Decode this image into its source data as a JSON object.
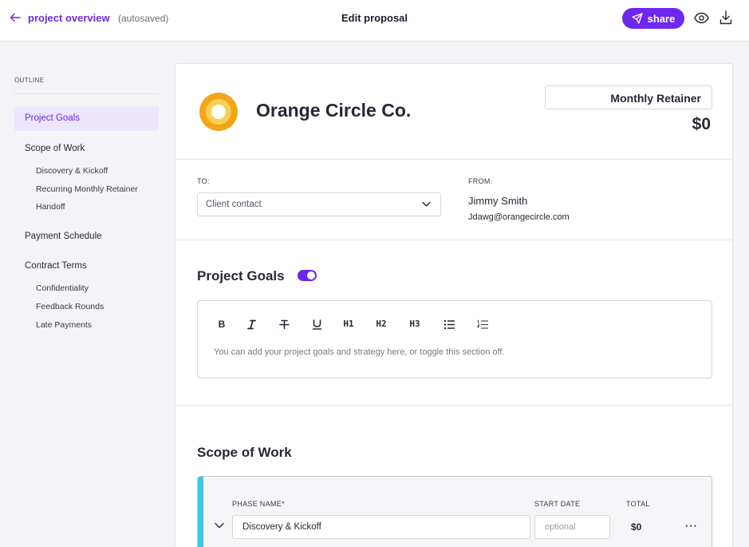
{
  "header": {
    "back_label": "project overview",
    "autosave_status": "(autosaved)",
    "title": "Edit proposal",
    "share_label": "share",
    "accent_color": "#6d28f0"
  },
  "sidebar": {
    "title": "OUTLINE",
    "items": [
      {
        "label": "Project Goals",
        "active": true,
        "children": []
      },
      {
        "label": "Scope of Work",
        "children": [
          "Discovery & Kickoff",
          "Recurring Monthly Retainer",
          "Handoff"
        ]
      },
      {
        "label": "Payment Schedule",
        "children": []
      },
      {
        "label": "Contract Terms",
        "children": [
          "Confidentiality",
          "Feedback Rounds",
          "Late Payments"
        ]
      }
    ]
  },
  "proposal": {
    "company_name": "Orange Circle Co.",
    "plan": "Monthly Retainer",
    "amount": "$0",
    "to_label": "TO:",
    "to_placeholder": "Client contact",
    "from_label": "FROM:",
    "from_name": "Jimmy Smith",
    "from_email": "Jdawg@orangecircle.com"
  },
  "project_goals": {
    "title": "Project Goals",
    "enabled": true,
    "toolbar": [
      "bold",
      "italic",
      "strikethrough",
      "underline",
      "H1",
      "H2",
      "H3",
      "bulleted-list",
      "numbered-list"
    ],
    "placeholder": "You can add your project goals and strategy here, or toggle this section off."
  },
  "scope_of_work": {
    "title": "Scope of Work",
    "columns": {
      "phase": "PHASE NAME*",
      "start": "START DATE",
      "total": "TOTAL"
    },
    "phases": [
      {
        "name": "Discovery & Kickoff",
        "start_placeholder": "optional",
        "total": "$0",
        "accent_color": "#3ec7e8"
      }
    ]
  }
}
